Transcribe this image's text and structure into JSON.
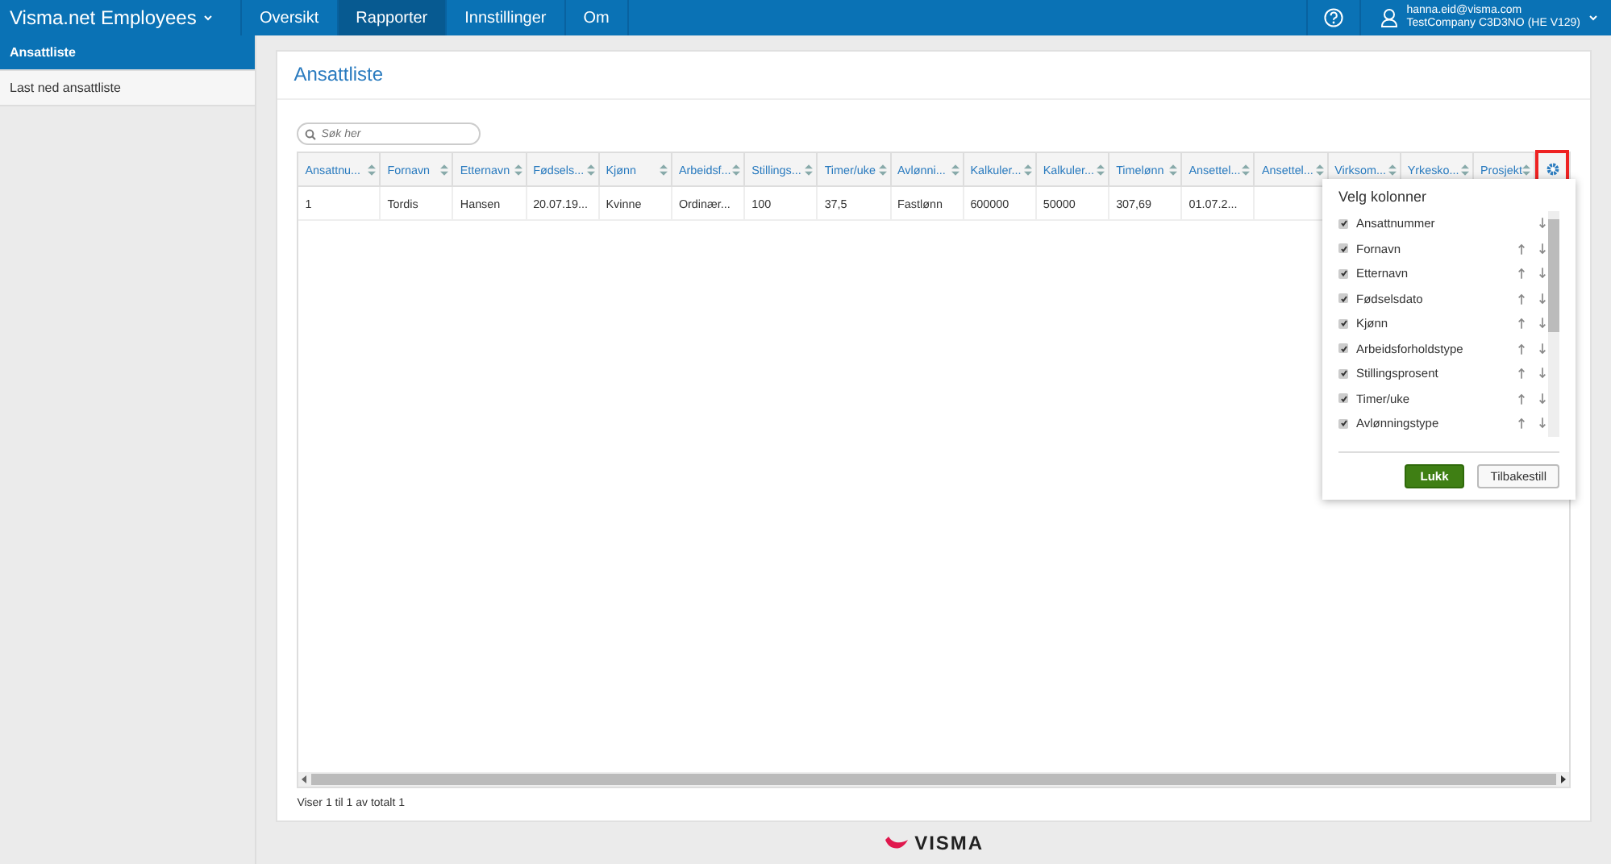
{
  "topbar": {
    "app_title": "Visma.net Employees",
    "nav": [
      {
        "label": "Oversikt",
        "selected": false
      },
      {
        "label": "Rapporter",
        "selected": true
      },
      {
        "label": "Innstillinger",
        "selected": false
      },
      {
        "label": "Om",
        "selected": false
      }
    ],
    "user_email": "hanna.eid@visma.com",
    "company": "TestCompany C3D3NO (HE V129)"
  },
  "sidebar": {
    "items": [
      {
        "label": "Ansattliste",
        "selected": true
      },
      {
        "label": "Last ned ansattliste",
        "selected": false
      }
    ]
  },
  "page": {
    "title": "Ansattliste",
    "search": {
      "placeholder": "Søk her"
    },
    "table": {
      "columns": [
        "Ansattnu...",
        "Fornavn",
        "Etternavn",
        "Fødsels...",
        "Kjønn",
        "Arbeidsf...",
        "Stillings...",
        "Timer/uke",
        "Avlønni...",
        "Kalkuler...",
        "Kalkuler...",
        "Timelønn",
        "Ansettel...",
        "Ansettel...",
        "Virksom...",
        "Yrkesko...",
        "Prosjekt"
      ],
      "rows": [
        [
          "1",
          "Tordis",
          "Hansen",
          "20.07.19...",
          "Kvinne",
          "Ordinær...",
          "100",
          "37,5",
          "Fastlønn",
          "600000",
          "50000",
          "307,69",
          "01.07.2...",
          "",
          "",
          "",
          ""
        ]
      ]
    },
    "footer": "Viser 1 til 1 av totalt 1"
  },
  "column_picker": {
    "title": "Velg kolonner",
    "items": [
      {
        "label": "Ansattnummer",
        "checked": true,
        "up": false
      },
      {
        "label": "Fornavn",
        "checked": true,
        "up": true
      },
      {
        "label": "Etternavn",
        "checked": true,
        "up": true
      },
      {
        "label": "Fødselsdato",
        "checked": true,
        "up": true
      },
      {
        "label": "Kjønn",
        "checked": true,
        "up": true
      },
      {
        "label": "Arbeidsforholdstype",
        "checked": true,
        "up": true
      },
      {
        "label": "Stillingsprosent",
        "checked": true,
        "up": true
      },
      {
        "label": "Timer/uke",
        "checked": true,
        "up": true
      },
      {
        "label": "Avlønningstype",
        "checked": true,
        "up": true
      }
    ],
    "buttons": [
      {
        "label": "Lukk",
        "kind": "primary"
      },
      {
        "label": "Tilbakestill",
        "kind": "secondary"
      }
    ]
  },
  "brand": "VISMA"
}
